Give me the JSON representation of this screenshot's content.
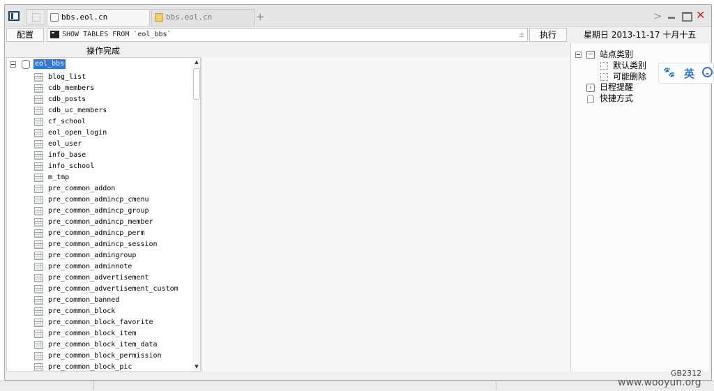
{
  "tabs": [
    {
      "label": "bbs.eol.cn",
      "icon": "page-icon",
      "active": true
    },
    {
      "label": "bbs.eol.cn",
      "icon": "folder-icon",
      "active": false
    }
  ],
  "toolbar": {
    "config_label": "配置",
    "command_text": "SHOW TABLES FROM `eol_bbs`",
    "command_adorn": "±",
    "run_label": "执行",
    "date_text": "星期日 2013-11-17 十月十五"
  },
  "status_text": "操作完成",
  "tree": {
    "root_label": "eol_bbs",
    "tables": [
      "blog_list",
      "cdb_members",
      "cdb_posts",
      "cdb_uc_members",
      "cf_school",
      "eol_open_login",
      "eol_user",
      "info_base",
      "info_school",
      "m_tmp",
      "pre_common_addon",
      "pre_common_admincp_cmenu",
      "pre_common_admincp_group",
      "pre_common_admincp_member",
      "pre_common_admincp_perm",
      "pre_common_admincp_session",
      "pre_common_admingroup",
      "pre_common_adminnote",
      "pre_common_advertisement",
      "pre_common_advertisement_custom",
      "pre_common_banned",
      "pre_common_block",
      "pre_common_block_favorite",
      "pre_common_block_item",
      "pre_common_block_item_data",
      "pre_common_block_permission",
      "pre_common_block_pic"
    ]
  },
  "right_panel": {
    "category_title": "站点类别",
    "sub_items": [
      "默认类别",
      "可能删除"
    ],
    "schedule": "日程提醒",
    "shortcuts": "快捷方式"
  },
  "ime": {
    "lang": "英"
  },
  "encoding": "GB2312",
  "watermark": "www.wooyun.org",
  "colors": {
    "selection": "#3378d8",
    "close_red": "#d21f1f",
    "ime_blue": "#2f6fce"
  }
}
